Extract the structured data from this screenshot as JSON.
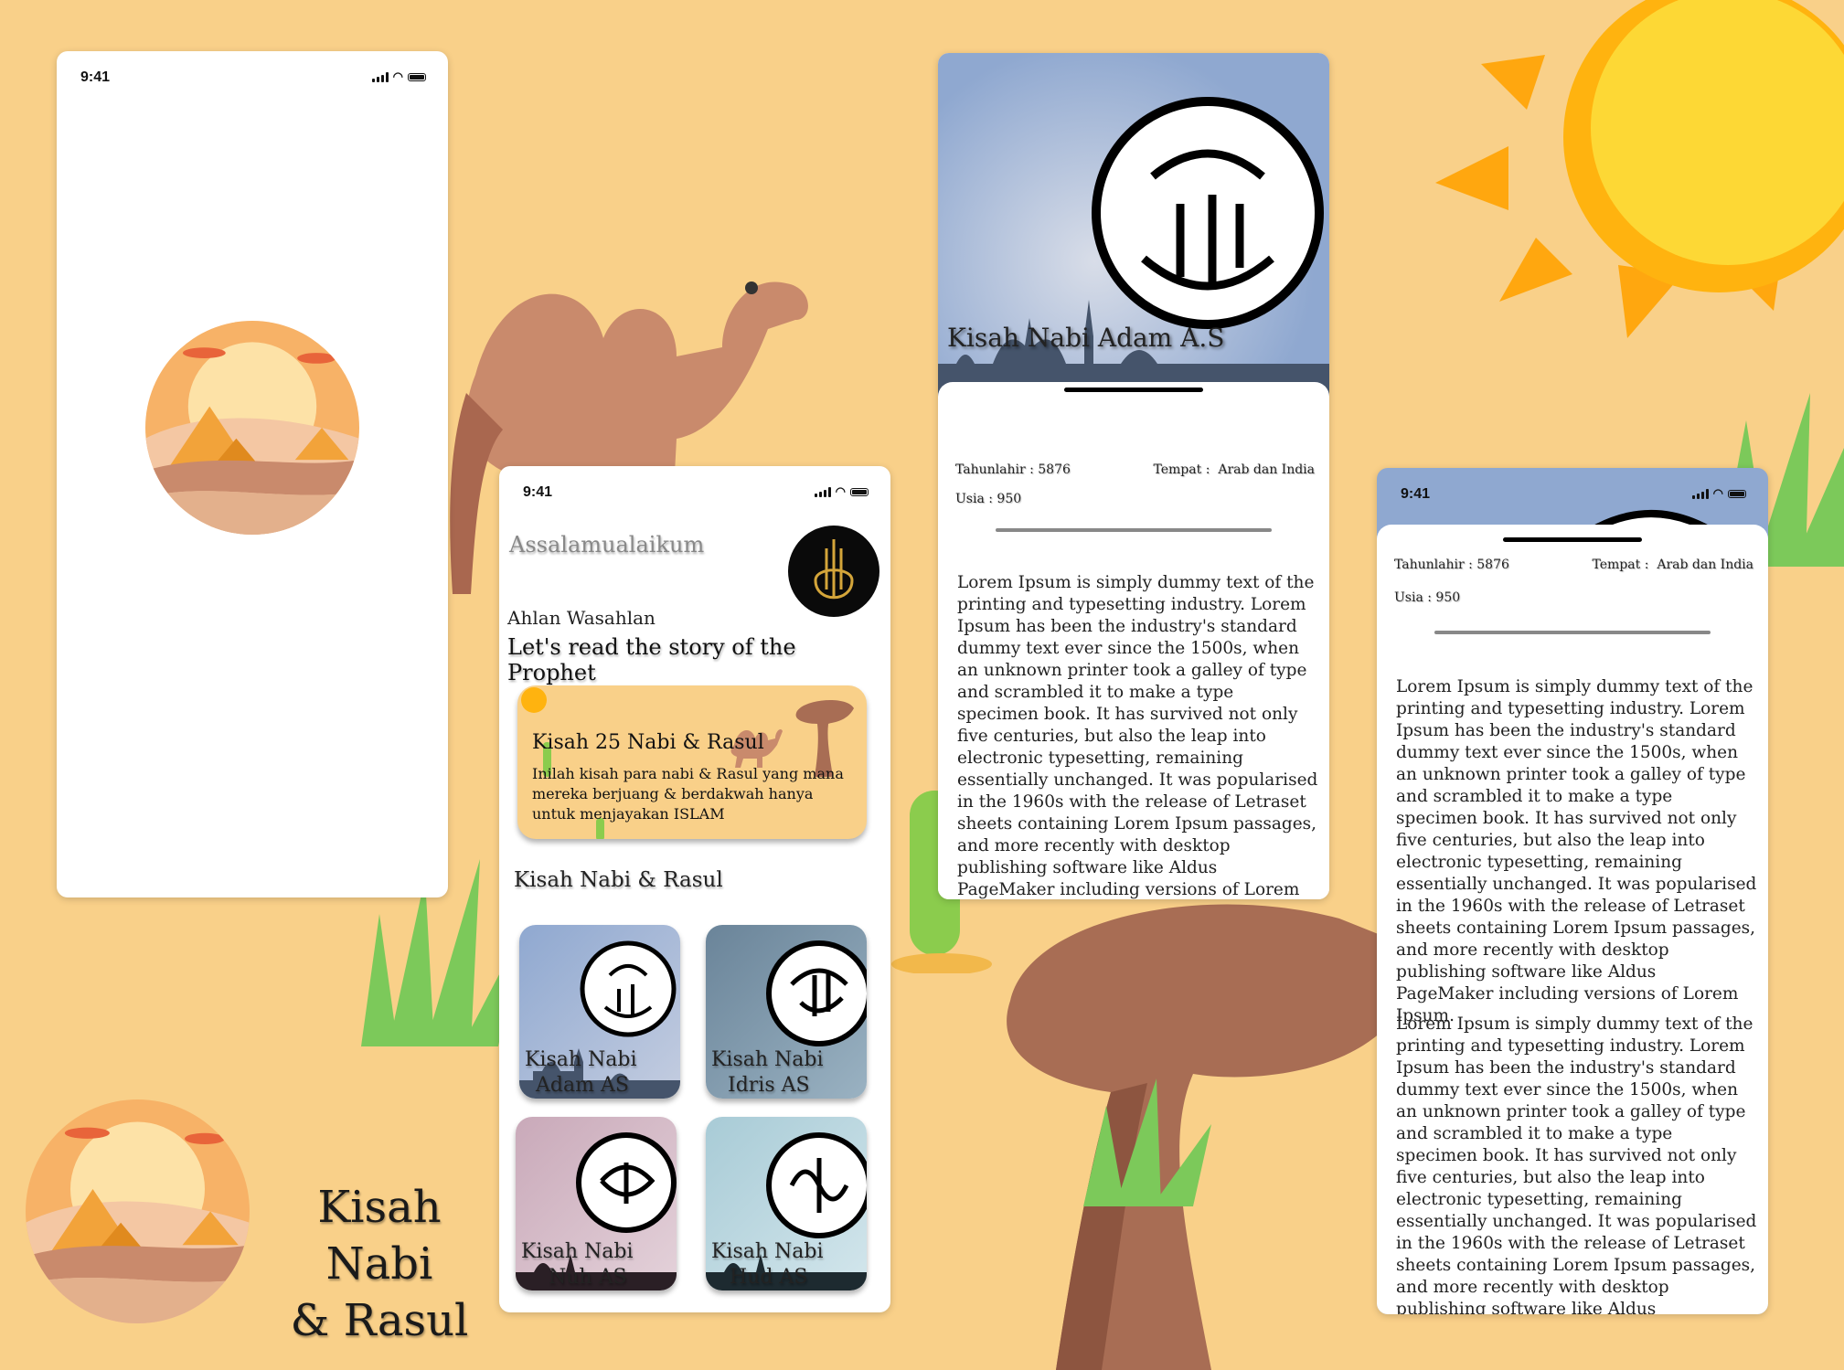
{
  "status": {
    "time": "9:41"
  },
  "brand": {
    "title_line1": "Kisah Nabi",
    "title_line2": "& Rasul"
  },
  "home": {
    "greeting": "Assalamualaikum",
    "welcome": "Ahlan Wasahlan",
    "headline": "Let's read the story of the Prophet",
    "banner": {
      "title": "Kisah 25 Nabi & Rasul",
      "description": "Inilah kisah para nabi & Rasul yang mana mereka berjuang & berdakwah hanya untuk menjayakan ISLAM"
    },
    "section_title": "Kisah Nabi & Rasul",
    "prophets": [
      {
        "line1": "Kisah Nabi",
        "line2": "Adam AS",
        "color": "#8fa8d0"
      },
      {
        "line1": "Kisah Nabi",
        "line2": "Idris AS",
        "color": "#6a8499"
      },
      {
        "line1": "Kisah Nabi",
        "line2": "Nuh AS",
        "color": "#c9a9b9"
      },
      {
        "line1": "Kisah Nabi",
        "line2": "Hud AS",
        "color": "#a8cbd6"
      }
    ]
  },
  "detail": {
    "title": "Kisah Nabi Adam A.S",
    "tahun_lahir": "Tahunlahir : 5876",
    "tempat_label": "Tempat :",
    "tempat_value": "Arab dan India",
    "usia": "Usia : 950",
    "paragraph": "Lorem Ipsum is simply dummy text of the printing and typesetting industry. Lorem Ipsum has been the industry's standard dummy text ever since the 1500s,  when an unknown printer took a galley of type and scrambled it to make a type specimen book. It has survived not only five centuries, but also the leap into electronic typesetting, remaining essentially unchanged. It was popularised in the 1960s with the release of Letraset sheets containing Lorem Ipsum passages, and more recently with desktop publishing software like Aldus PageMaker including versions of Lorem Ipsum.",
    "paragraph2": "Lorem Ipsum is simply dummy text of the printing and typesetting industry. Lorem Ipsum has been the industry's standard dummy text ever since the 1500s,  when an unknown printer took a galley of type and scrambled it to make a type specimen book. It has survived not only five centuries, but also the leap into electronic typesetting, remaining essentially unchanged. It was popularised in the 1960s with the release of Letraset sheets containing Lorem Ipsum passages, and more recently with desktop publishing software like Aldus PageMaker including"
  },
  "colors": {
    "background": "#f9d089",
    "sun": "#fcc419",
    "camel": "#c98a6c",
    "grass": "#7cc95a",
    "rock": "#a86d54"
  }
}
